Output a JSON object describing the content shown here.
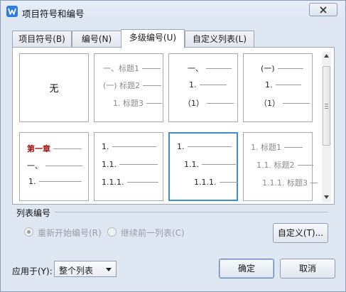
{
  "window": {
    "title": "项目符号和编号",
    "close_icon": "close-icon"
  },
  "tabs": [
    {
      "label": "项目符号(B)"
    },
    {
      "label": "编号(N)"
    },
    {
      "label": "多级编号(U)",
      "active": true
    },
    {
      "label": "自定义列表(L)"
    }
  ],
  "gallery": {
    "none_label": "无",
    "cells": [
      {
        "rows": [
          {
            "text": "一、标题1"
          },
          {
            "text": "(一) 标题2"
          },
          {
            "text": "1. 标题3"
          }
        ]
      },
      {
        "rows": [
          {
            "text": "一、"
          },
          {
            "text": "1."
          },
          {
            "text": "（1）"
          }
        ]
      },
      {
        "rows": [
          {
            "text": "(一)"
          },
          {
            "text": "1."
          },
          {
            "text": "（1）"
          }
        ]
      },
      {
        "rows": [
          {
            "text": "第一章"
          },
          {
            "text": "一、"
          },
          {
            "text": "1."
          }
        ]
      },
      {
        "rows": [
          {
            "text": "1."
          },
          {
            "text": "1.1."
          },
          {
            "text": "1.1.1."
          }
        ]
      },
      {
        "rows": [
          {
            "text": "1."
          },
          {
            "text": "1.1."
          },
          {
            "text": "1.1.1."
          }
        ],
        "selected": true
      },
      {
        "rows": [
          {
            "text": "1. 标题1"
          },
          {
            "text": "1.1. 标题2"
          },
          {
            "text": "1.1.1. 标题3"
          }
        ]
      }
    ]
  },
  "list_numbering": {
    "group_label": "列表编号",
    "restart_label": "重新开始编号(R)",
    "continue_label": "继续前一列表(C)",
    "customize_label": "自定义(T)..."
  },
  "footer": {
    "apply_label": "应用于(Y):",
    "apply_value": "整个列表",
    "ok_label": "确定",
    "cancel_label": "取消"
  },
  "colors": {
    "selection": "#3b8fd6",
    "accent": "#2f7de1",
    "red_heading": "#9c1010"
  }
}
